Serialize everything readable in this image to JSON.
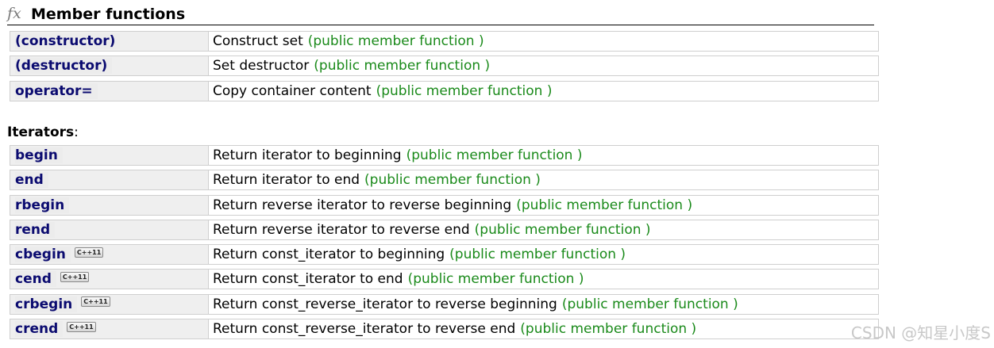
{
  "header": {
    "icon": "fx-icon",
    "title": "Member functions"
  },
  "members_group": [
    {
      "name": "(constructor)",
      "cxx11": false,
      "description": "Construct set",
      "kind": "(public member function )"
    },
    {
      "name": "(destructor)",
      "cxx11": false,
      "description": "Set destructor",
      "kind": "(public member function )"
    },
    {
      "name": "operator=",
      "cxx11": false,
      "description": "Copy container content",
      "kind": "(public member function )"
    }
  ],
  "iterators_label": "Iterators",
  "iterators_colon": ":",
  "iterators_group": [
    {
      "name": "begin",
      "cxx11": false,
      "description": "Return iterator to beginning",
      "kind": "(public member function )"
    },
    {
      "name": "end",
      "cxx11": false,
      "description": "Return iterator to end",
      "kind": "(public member function )"
    },
    {
      "name": "rbegin",
      "cxx11": false,
      "description": "Return reverse iterator to reverse beginning",
      "kind": "(public member function )"
    },
    {
      "name": "rend",
      "cxx11": false,
      "description": "Return reverse iterator to reverse end",
      "kind": "(public member function )"
    },
    {
      "name": "cbegin",
      "cxx11": true,
      "description": "Return const_iterator to beginning",
      "kind": "(public member function )"
    },
    {
      "name": "cend",
      "cxx11": true,
      "description": "Return const_iterator to end",
      "kind": "(public member function )"
    },
    {
      "name": "crbegin",
      "cxx11": true,
      "description": "Return const_reverse_iterator to reverse beginning",
      "kind": "(public member function )"
    },
    {
      "name": "crend",
      "cxx11": true,
      "description": "Return const_reverse_iterator to reverse end",
      "kind": "(public member function )"
    }
  ],
  "badge_label": "C++11",
  "watermark": "CSDN @知星小度S",
  "colors": {
    "name": "#0b0b70",
    "kind": "#1a8a1a",
    "name_bg": "#efefef",
    "border": "#cfcfcf"
  }
}
